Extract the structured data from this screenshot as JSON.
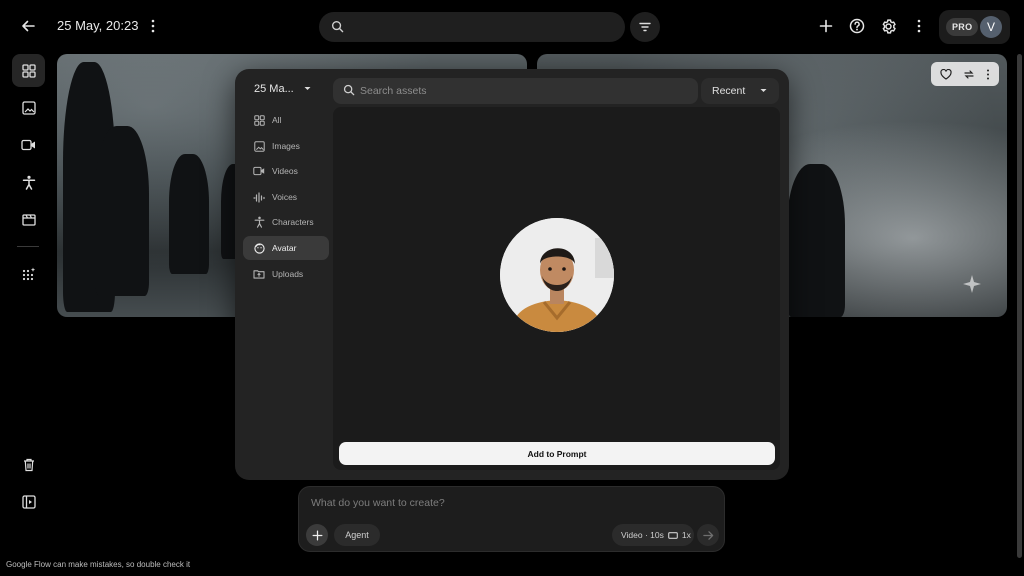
{
  "header": {
    "title": "25 May, 20:23",
    "search_placeholder": "",
    "plan_badge": "PRO",
    "user_initial": "V"
  },
  "icons": {
    "back": "arrow-left-icon",
    "more": "more-vertical-icon",
    "search": "search-icon",
    "filter": "filter-icon",
    "add": "plus-icon",
    "help": "help-icon",
    "settings": "gear-icon"
  },
  "rail": {
    "items": [
      "grid-icon",
      "image-icon",
      "video-icon",
      "character-icon",
      "scenes-icon",
      "apps-icon",
      "trash-icon",
      "panel-icon"
    ]
  },
  "modal": {
    "project_label": "25 Ma...",
    "search_placeholder": "Search assets",
    "sort_label": "Recent",
    "nav": [
      {
        "label": "All",
        "icon": "grid-icon",
        "active": false
      },
      {
        "label": "Images",
        "icon": "image-icon",
        "active": false
      },
      {
        "label": "Videos",
        "icon": "video-icon",
        "active": false
      },
      {
        "label": "Voices",
        "icon": "voice-icon",
        "active": false
      },
      {
        "label": "Characters",
        "icon": "character-icon",
        "active": false
      },
      {
        "label": "Avatar",
        "icon": "avatar-icon",
        "active": true
      },
      {
        "label": "Uploads",
        "icon": "upload-folder-icon",
        "active": false
      }
    ],
    "add_button": "Add to Prompt"
  },
  "prompt": {
    "placeholder": "What do you want to create?",
    "agent_label": "Agent",
    "settings_label": "Video · 10s",
    "ratio_icon": "aspect-ratio-icon",
    "count_label": "1x"
  },
  "footer": {
    "disclaimer": "Google Flow can make mistakes, so double check it"
  },
  "colors": {
    "background": "#000000",
    "modal": "#232323",
    "active_nav": "#3a3a3a",
    "primary_button": "#f3f3f3"
  }
}
